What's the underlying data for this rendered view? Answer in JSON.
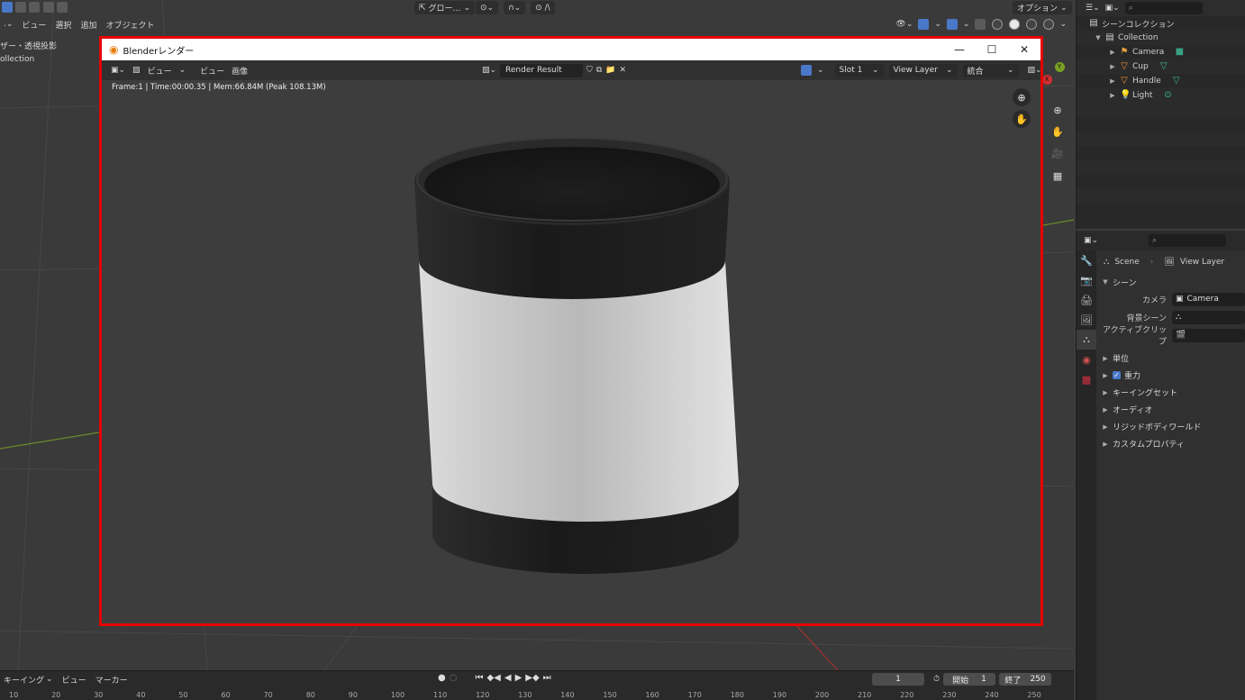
{
  "viewport": {
    "header": {
      "menu_view": "ビュー",
      "menu_select": "選択",
      "menu_add": "追加",
      "menu_object": "オブジェクト",
      "transform_orientation": "グロー…",
      "options": "オプション"
    },
    "overlay_text_line1": "ザー・透視投影",
    "overlay_text_line2": "ollection"
  },
  "render_window": {
    "title": "Blenderレンダー",
    "menu_view1": "ビュー",
    "menu_view2": "ビュー",
    "menu_image": "画像",
    "image_name": "Render Result",
    "slot": "Slot 1",
    "view_layer": "View Layer",
    "pass": "統合",
    "stats": "Frame:1 | Time:00:00.35 | Mem:66.84M (Peak 108.13M)",
    "minimize": "—",
    "maximize": "☐",
    "close": "✕"
  },
  "outliner": {
    "scene_collection": "シーンコレクション",
    "collection": "Collection",
    "items": [
      {
        "name": "Camera",
        "icon": "camera-icon",
        "color": "#e8a040"
      },
      {
        "name": "Cup",
        "icon": "mesh-icon",
        "color": "#f09030"
      },
      {
        "name": "Handle",
        "icon": "mesh-icon",
        "color": "#f09030"
      },
      {
        "name": "Light",
        "icon": "light-icon",
        "color": "#f09030"
      }
    ]
  },
  "properties": {
    "crumb_scene": "Scene",
    "crumb_view_layer": "View Layer",
    "panel_scene": "シーン",
    "camera_label": "カメラ",
    "camera_value": "Camera",
    "bg_scene_label": "背景シーン",
    "active_clip_label": "アクティブクリップ",
    "sub_panels": [
      "単位",
      "重力",
      "キーイングセット",
      "オーディオ",
      "リジッドボディワールド",
      "カスタムプロパティ"
    ]
  },
  "timeline": {
    "keying": "キーイング",
    "view": "ビュー",
    "marker": "マーカー",
    "current_frame": "1",
    "start_label": "開始",
    "start_value": "1",
    "end_label": "終了",
    "end_value": "250",
    "ruler": [
      "10",
      "20",
      "30",
      "40",
      "50",
      "60",
      "70",
      "80",
      "90",
      "100",
      "110",
      "120",
      "130",
      "140",
      "150",
      "160",
      "170",
      "180",
      "190",
      "200",
      "210",
      "220",
      "230",
      "240",
      "250"
    ]
  },
  "colors": {
    "highlight_border": "#e60000",
    "accent_blue": "#4a78c8"
  }
}
